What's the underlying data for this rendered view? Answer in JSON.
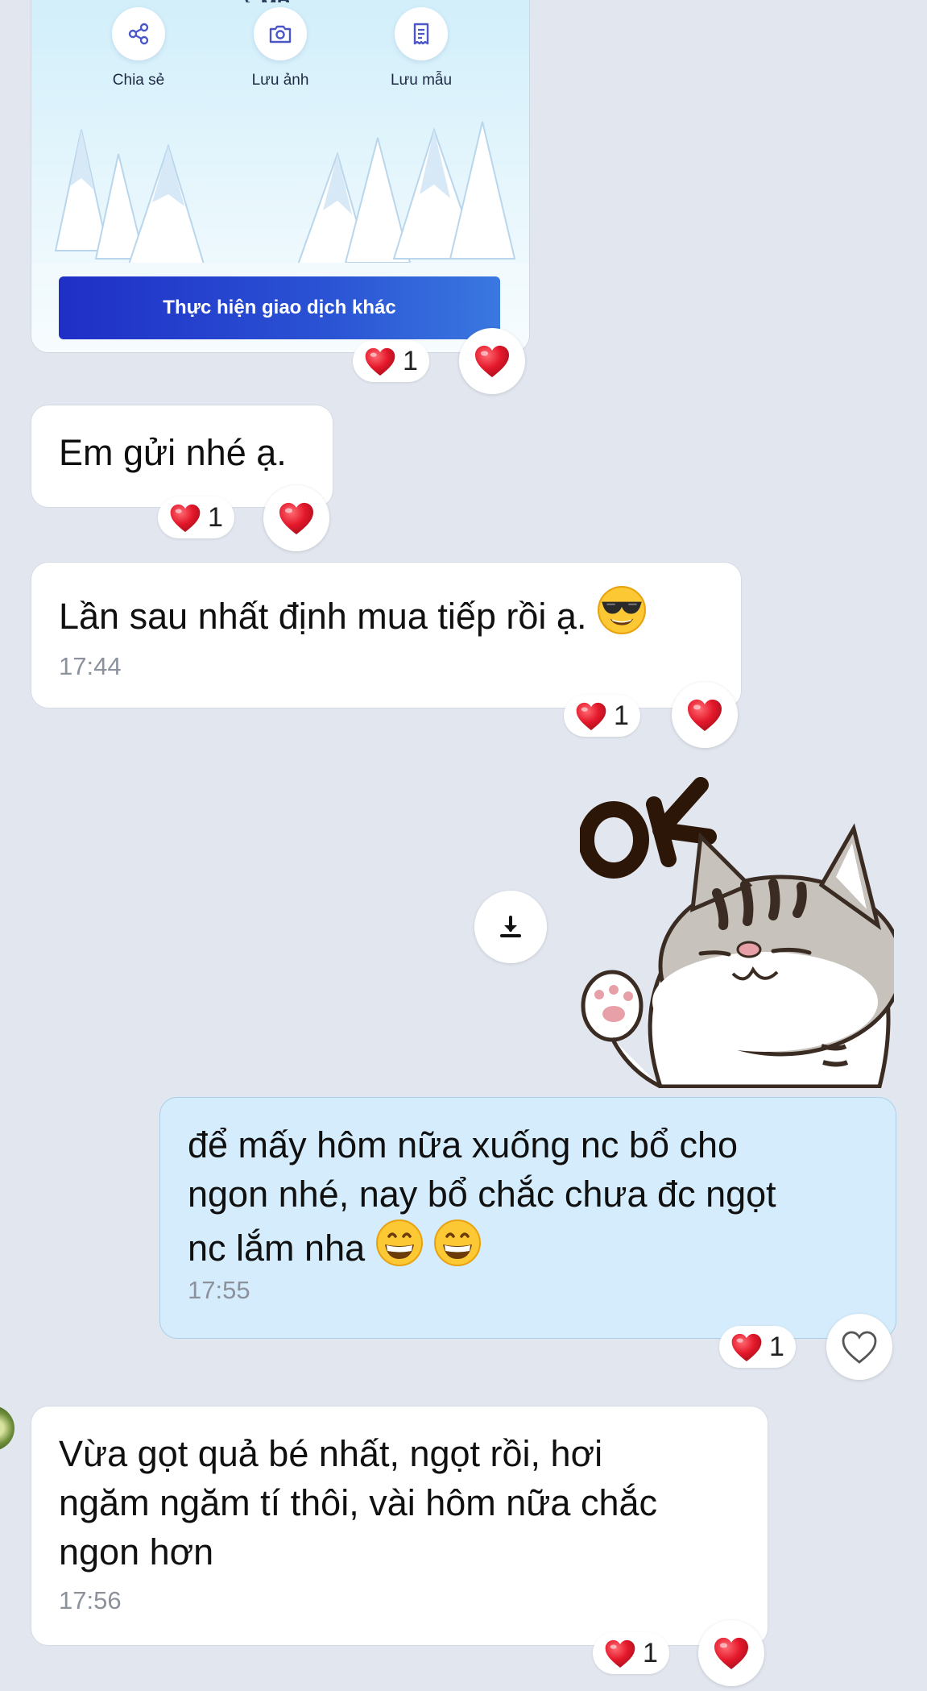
{
  "transfer_card": {
    "actions": [
      {
        "label": "Chia sẻ",
        "icon": "share-icon"
      },
      {
        "label": "Lưu ảnh",
        "icon": "camera-icon"
      },
      {
        "label": "Lưu mẫu",
        "icon": "receipt-icon"
      }
    ],
    "button_label": "Thực hiện giao dịch khác",
    "reaction_count": "1"
  },
  "messages": [
    {
      "id": "m1",
      "sender": "other",
      "text": "Em gửi nhé ạ.",
      "time": "",
      "reaction_count": "1"
    },
    {
      "id": "m2",
      "sender": "other",
      "text": "Lần sau nhất định mua tiếp rồi ạ.",
      "emoji": "smiling-face-with-sunglasses",
      "time": "17:44",
      "reaction_count": "1"
    },
    {
      "id": "m3",
      "sender": "other",
      "type": "sticker",
      "sticker": "OK cat sticker",
      "sticker_text": "OK"
    },
    {
      "id": "m4",
      "sender": "me",
      "text_line1": "để mấy hôm nữa xuống nc bổ cho",
      "text_line2": "ngon nhé, nay bổ chắc chưa đc ngọt",
      "text_line3": "nc lắm nha",
      "emoji": "grinning-face",
      "time": "17:55",
      "reaction_count": "1"
    },
    {
      "id": "m5",
      "sender": "other",
      "text_line1": "Vừa gọt quả bé nhất, ngọt rồi, hơi",
      "text_line2": "ngăm ngăm tí thôi, vài hôm nữa chắc",
      "text_line3": "ngon hơn",
      "time": "17:56",
      "reaction_count": "1"
    }
  ],
  "colors": {
    "background": "#e2e6ef",
    "bubble_other": "#ffffff",
    "bubble_mine": "#d4ecfc",
    "heart": "#e4182b",
    "button_gradient_start": "#1f2fc6"
  }
}
